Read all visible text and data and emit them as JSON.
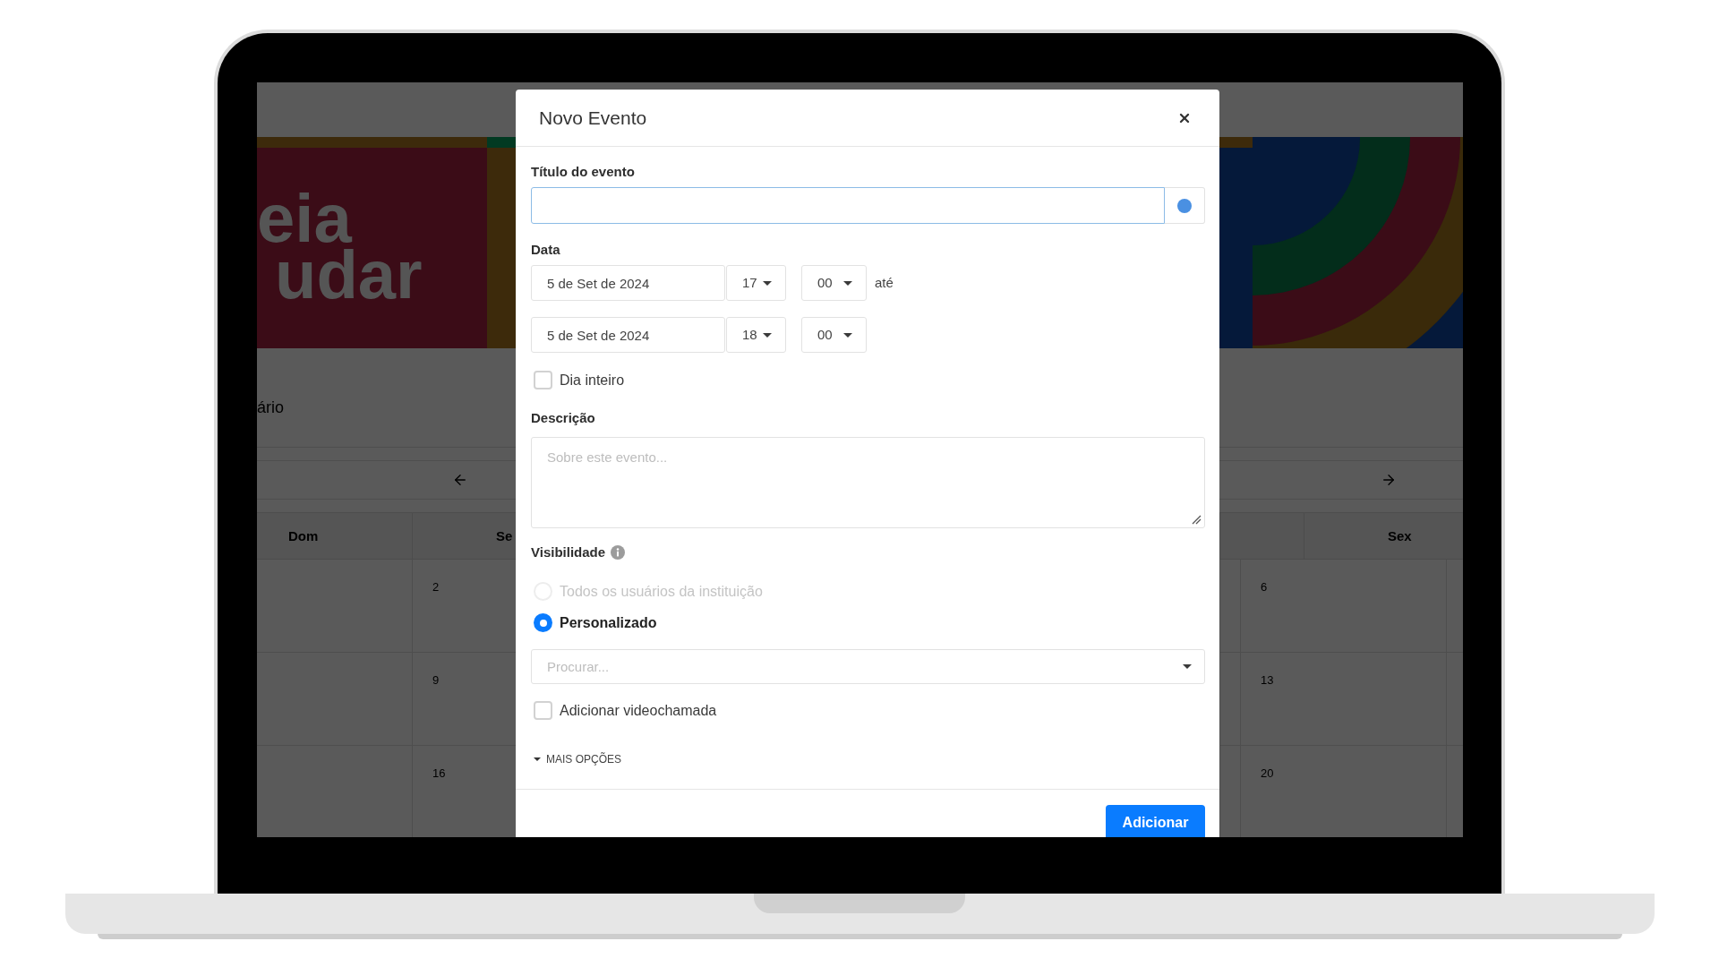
{
  "background": {
    "banner": {
      "lines": [
        "eia",
        "udar"
      ]
    },
    "page_title": "ário",
    "calendar": {
      "left_columns": [
        {
          "label": "Dom"
        },
        {
          "label": "Se",
          "days": [
            "2",
            "9",
            "16"
          ]
        }
      ],
      "right_columns": [
        {
          "label": "Sex",
          "days": [
            "6",
            "13",
            "20"
          ]
        }
      ]
    }
  },
  "modal": {
    "title": "Novo Evento",
    "event_title": {
      "label": "Título do evento",
      "focused": true
    },
    "date": {
      "label": "Data",
      "rows": [
        {
          "date": "5 de Set de 2024",
          "hour": "17",
          "minute": "00",
          "suffix": "até"
        },
        {
          "date": "5 de Set de 2024",
          "hour": "18",
          "minute": "00"
        }
      ]
    },
    "all_day": {
      "label": "Dia inteiro",
      "checked": false
    },
    "description": {
      "label": "Descrição",
      "placeholder": "Sobre este evento..."
    },
    "visibility": {
      "label": "Visibilidade",
      "options": [
        {
          "label": "Todos os usuários da instituição",
          "selected": false,
          "disabled": true
        },
        {
          "label": "Personalizado",
          "selected": true,
          "disabled": false
        }
      ],
      "search": {
        "placeholder": "Procurar..."
      }
    },
    "video_call": {
      "label": "Adicionar videochamada",
      "checked": false
    },
    "more_options": "MAIS OPÇÕES",
    "submit": "Adicionar"
  }
}
